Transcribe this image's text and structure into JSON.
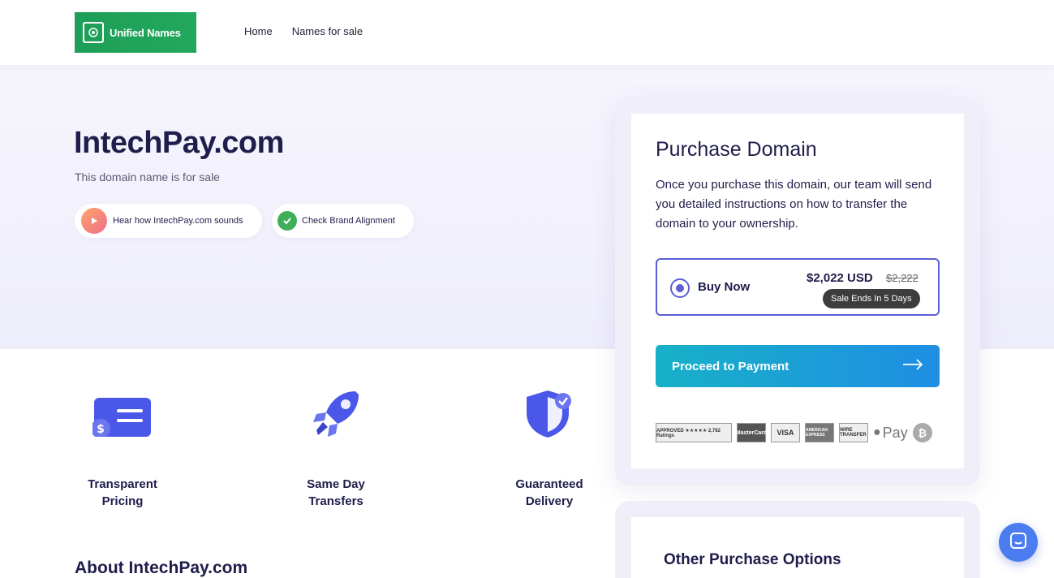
{
  "header": {
    "logo_text": "Unified Names",
    "nav": {
      "home": "Home",
      "names_for_sale": "Names for sale"
    }
  },
  "hero": {
    "domain": "IntechPay.com",
    "subtitle": "This domain name is for sale",
    "sound_pill": "Hear how IntechPay.com sounds",
    "brand_pill": "Check Brand Alignment"
  },
  "features": [
    {
      "line1": "Transparent",
      "line2": "Pricing",
      "icon": "pricing-card-icon"
    },
    {
      "line1": "Same Day",
      "line2": "Transfers",
      "icon": "rocket-icon"
    },
    {
      "line1": "Guaranteed",
      "line2": "Delivery",
      "icon": "shield-check-icon"
    }
  ],
  "about_title": "About IntechPay.com",
  "purchase": {
    "title": "Purchase Domain",
    "description": "Once you purchase this domain, our team will send you detailed instructions on how to transfer the domain to your ownership.",
    "option_label": "Buy Now",
    "price": "$2,022 USD",
    "old_price": "$2,222",
    "sale_badge": "Sale Ends In 5 Days",
    "button_label": "Proceed to Payment",
    "payment_badges": [
      "APPROVED ★★★★★ 2,782 Ratings",
      "MasterCard",
      "VISA",
      "AMERICAN EXPRESS",
      "WIRE TRANSFER",
      "Pay"
    ]
  },
  "other_options_title": "Other Purchase Options",
  "colors": {
    "accent": "#5b5fd6",
    "brand_green": "#1e9e57",
    "button_start": "#17b1c8",
    "button_end": "#1f8ee3"
  }
}
